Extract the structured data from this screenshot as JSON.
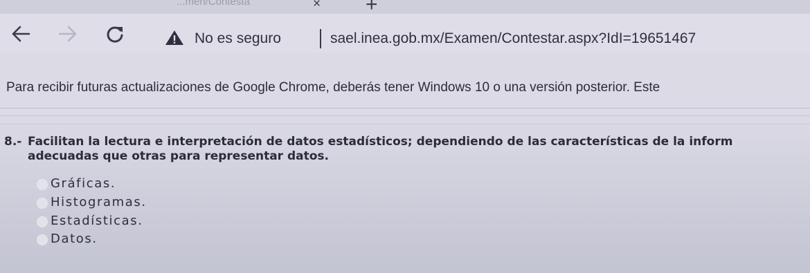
{
  "browser": {
    "tab_title": "...men/Contesta",
    "close_tab_glyph": "×",
    "new_tab_glyph": "+",
    "back_icon": "arrow-left-icon",
    "forward_icon": "arrow-right-icon",
    "reload_icon": "reload-icon",
    "security_icon": "warning-triangle-icon",
    "security_text": "No es seguro",
    "url": "sael.inea.gob.mx/Examen/Contestar.aspx?IdI=19651467"
  },
  "infobar": {
    "message": "Para recibir futuras actualizaciones de Google Chrome, deberás tener Windows 10 o una versión posterior. Este"
  },
  "question": {
    "number": "8.-",
    "text_line1": "Facilitan la lectura e interpretación de datos estadísticos; dependiendo de las características de la inform",
    "text_line2": "adecuadas que otras para representar datos.",
    "options": [
      {
        "label": "Gráficas."
      },
      {
        "label": "Histogramas."
      },
      {
        "label": "Estadísticas."
      },
      {
        "label": "Datos."
      }
    ]
  },
  "colors": {
    "page_bg": "#d9d8e4",
    "text": "#2b2b3b"
  }
}
